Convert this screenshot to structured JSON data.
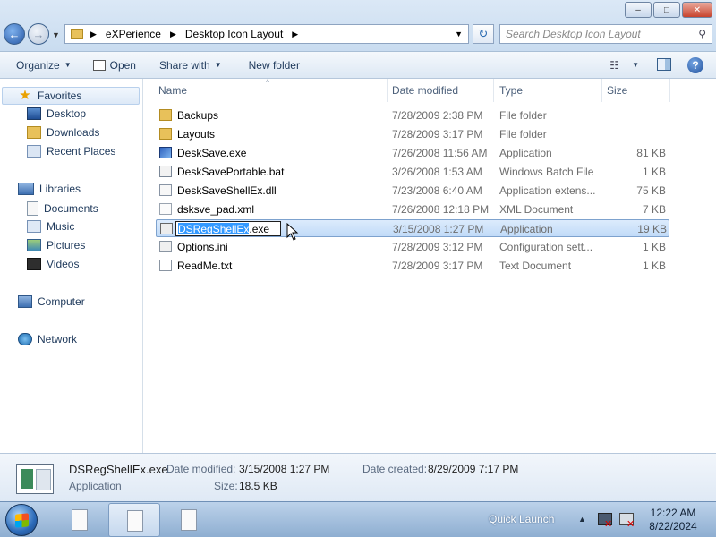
{
  "window": {
    "minimize_label": "–",
    "maximize_label": "□",
    "close_label": "✕"
  },
  "address": {
    "path": [
      "eXPerience",
      "Desktop Icon Layout"
    ],
    "separator": "▶",
    "dropdown": "▼"
  },
  "search": {
    "placeholder": "Search Desktop Icon Layout",
    "icon": "magnifier-icon"
  },
  "toolbar": {
    "organize": "Organize",
    "open": "Open",
    "share_with": "Share with",
    "new_folder": "New folder",
    "caret": "▼",
    "help": "?"
  },
  "nav": {
    "favorites": "Favorites",
    "desktop": "Desktop",
    "downloads": "Downloads",
    "recent_places": "Recent Places",
    "libraries": "Libraries",
    "documents": "Documents",
    "music": "Music",
    "pictures": "Pictures",
    "videos": "Videos",
    "computer": "Computer",
    "network": "Network"
  },
  "columns": {
    "name": "Name",
    "date_modified": "Date modified",
    "type": "Type",
    "size": "Size",
    "sort_arrow": "˄"
  },
  "files": [
    {
      "name": "Backups",
      "date": "7/28/2009 2:38 PM",
      "type": "File folder",
      "size": "",
      "icon": "folder-icon"
    },
    {
      "name": "Layouts",
      "date": "7/28/2009 3:17 PM",
      "type": "File folder",
      "size": "",
      "icon": "folder-icon"
    },
    {
      "name": "DeskSave.exe",
      "date": "7/26/2008 11:56 AM",
      "type": "Application",
      "size": "81 KB",
      "icon": "application-icon"
    },
    {
      "name": "DeskSavePortable.bat",
      "date": "3/26/2008 1:53 AM",
      "type": "Windows Batch File",
      "size": "1 KB",
      "icon": "batch-file-icon"
    },
    {
      "name": "DeskSaveShellEx.dll",
      "date": "7/23/2008 6:40 AM",
      "type": "Application extens...",
      "size": "75 KB",
      "icon": "dll-file-icon"
    },
    {
      "name": "dsksve_pad.xml",
      "date": "7/26/2008 12:18 PM",
      "type": "XML Document",
      "size": "7 KB",
      "icon": "xml-file-icon"
    },
    {
      "name": "DSRegShellEx.exe",
      "rename_selected": "DSRegShellEx",
      "rename_rest": ".exe",
      "date": "3/15/2008 1:27 PM",
      "type": "Application",
      "size": "19 KB",
      "icon": "application-icon"
    },
    {
      "name": "Options.ini",
      "date": "7/28/2009 3:12 PM",
      "type": "Configuration sett...",
      "size": "1 KB",
      "icon": "ini-file-icon"
    },
    {
      "name": "ReadMe.txt",
      "date": "7/28/2009 3:17 PM",
      "type": "Text Document",
      "size": "1 KB",
      "icon": "text-file-icon"
    }
  ],
  "details": {
    "filename": "DSRegShellEx.exe",
    "type": "Application",
    "date_modified_label": "Date modified:",
    "date_modified": "3/15/2008 1:27 PM",
    "date_created_label": "Date created:",
    "date_created": "8/29/2009 7:17 PM",
    "size_label": "Size:",
    "size": "18.5 KB"
  },
  "taskbar": {
    "quick_launch": "Quick Launch",
    "tray_arrow": "▲",
    "time": "12:22 AM",
    "date": "8/22/2024"
  }
}
